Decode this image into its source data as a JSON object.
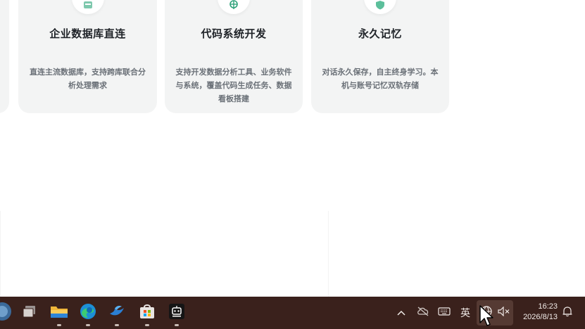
{
  "features": [
    {
      "title": "企业数据库直连",
      "description": "直连主流数据库，支持跨库联合分析处理需求",
      "icon": "database-icon"
    },
    {
      "title": "代码系统开发",
      "description": "支持开发数据分析工具、业务软件与系统，覆盖代码生成任务、数据看板搭建",
      "icon": "code-globe-icon"
    },
    {
      "title": "永久记忆",
      "description": "对话永久保存，自主终身学习。本机与账号记忆双轨存储",
      "icon": "shield-memory-icon"
    }
  ],
  "taskbar": {
    "apps": [
      {
        "name": "start-menu",
        "icon": "windows-logo-icon"
      },
      {
        "name": "task-view",
        "icon": "task-view-icon"
      },
      {
        "name": "file-explorer",
        "icon": "folder-icon"
      },
      {
        "name": "edge",
        "icon": "edge-browser-icon"
      },
      {
        "name": "app-bird",
        "icon": "bird-app-icon"
      },
      {
        "name": "ms-store",
        "icon": "store-icon"
      },
      {
        "name": "ai-agent",
        "icon": "robot-app-icon"
      }
    ],
    "tray": {
      "ime_label": "英",
      "time": "16:23",
      "date": "2026/8/13"
    }
  },
  "colors": {
    "card_bg": "#f3f4f4",
    "taskbar_bg": "#3a211c",
    "icon_accent": "#2fa27a"
  }
}
